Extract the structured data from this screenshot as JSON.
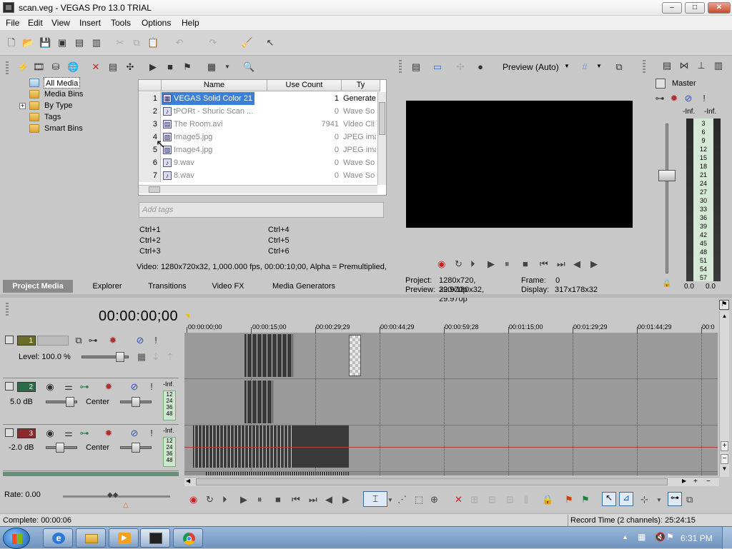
{
  "window": {
    "title": "scan.veg - VEGAS Pro 13.0 TRIAL",
    "min": "–",
    "max": "□",
    "close": "✕"
  },
  "menu": [
    "File",
    "Edit",
    "View",
    "Insert",
    "Tools",
    "Options",
    "Help"
  ],
  "media_tree": {
    "items": [
      "All Media",
      "Media Bins",
      "By Type",
      "Tags",
      "Smart Bins"
    ],
    "expander": "+"
  },
  "file_list": {
    "headers": [
      "Name",
      "Use Count",
      "Ty"
    ],
    "rows": [
      {
        "num": "1",
        "name": "VEGAS Solid Color 21",
        "count": "1",
        "type": "Generate"
      },
      {
        "num": "2",
        "name": "tPORt - Shuric Scan ...",
        "count": "0",
        "type": "Wave So"
      },
      {
        "num": "3",
        "name": "The Room.avi",
        "count": "7941",
        "type": "Video Cli"
      },
      {
        "num": "4",
        "name": "Image5.jpg",
        "count": "0",
        "type": "JPEG ima"
      },
      {
        "num": "5",
        "name": "Image4.jpg",
        "count": "0",
        "type": "JPEG ima"
      },
      {
        "num": "6",
        "name": "9.wav",
        "count": "0",
        "type": "Wave So"
      },
      {
        "num": "7",
        "name": "8.wav",
        "count": "0",
        "type": "Wave So"
      }
    ]
  },
  "tags": {
    "placeholder": "Add tags",
    "shortcuts": [
      "Ctrl+1",
      "Ctrl+4",
      "Ctrl+2",
      "Ctrl+5",
      "Ctrl+3",
      "Ctrl+6"
    ]
  },
  "media_status": "Video: 1280x720x32, 1,000.000 fps, 00:00:10;00, Alpha = Premultiplied,",
  "bottom_tabs": [
    "Project Media",
    "Explorer",
    "Transitions",
    "Video FX",
    "Media Generators"
  ],
  "preview": {
    "mode": "Preview (Auto)",
    "project_label": "Project:",
    "project_value": "1280x720, 29.970p",
    "frame_label": "Frame:",
    "frame_value": "0",
    "preview_label": "Preview:",
    "preview_value": "320x180x32, 29.970p",
    "display_label": "Display:",
    "display_value": "317x178x32"
  },
  "master": {
    "title": "Master",
    "inf_left": "-Inf.",
    "inf_right": "-Inf.",
    "scale": [
      "3",
      "6",
      "9",
      "12",
      "15",
      "18",
      "21",
      "24",
      "27",
      "30",
      "33",
      "36",
      "39",
      "42",
      "45",
      "48",
      "51",
      "54",
      "57"
    ],
    "val_left": "0.0",
    "val_right": "0.0"
  },
  "timeline": {
    "timecode": "00:00:00;00",
    "ruler": [
      "00:00:00;00",
      "00:00:15;00",
      "00:00:29;29",
      "00:00:44;29",
      "00:00:59;28",
      "00:01:15;00",
      "00:01:29;29",
      "00:01:44;29",
      "00:0"
    ],
    "tracks": [
      {
        "num": "1",
        "level_label": "Level: 100.0 %",
        "color": "#6b6b2a"
      },
      {
        "num": "2",
        "vol": "5.0 dB",
        "pan": "Center",
        "inf": "-Inf.",
        "color": "#2a6b4a"
      },
      {
        "num": "3",
        "vol": "-2.0 dB",
        "pan": "Center",
        "inf": "-Inf.",
        "color": "#8a2a2a"
      }
    ],
    "mini_scale": [
      "12",
      "24",
      "36",
      "48"
    ]
  },
  "rate": "Rate: 0.00",
  "status": {
    "left": "Complete: 00:00:06",
    "right": "Record Time (2 channels): 25:24:15"
  },
  "taskbar": {
    "clock": "6:31 PM"
  }
}
